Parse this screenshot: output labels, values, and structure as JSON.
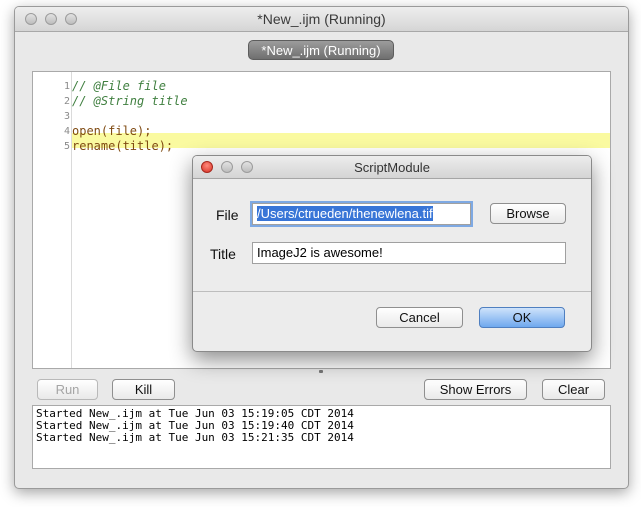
{
  "main_window": {
    "title": "*New_.ijm (Running)",
    "tab_label": "*New_.ijm (Running)"
  },
  "editor": {
    "lines": [
      {
        "num": "1",
        "text": "// @File file"
      },
      {
        "num": "2",
        "text": "// @String title"
      },
      {
        "num": "3",
        "text": ""
      },
      {
        "num": "4",
        "text": "open(file);"
      },
      {
        "num": "5",
        "text": "rename(title);"
      }
    ]
  },
  "toolbar": {
    "run_label": "Run",
    "kill_label": "Kill",
    "show_errors_label": "Show Errors",
    "clear_label": "Clear"
  },
  "console": {
    "lines": [
      "Started New_.ijm at Tue Jun 03 15:19:05 CDT 2014",
      "Started New_.ijm at Tue Jun 03 15:19:40 CDT 2014",
      "Started New_.ijm at Tue Jun 03 15:21:35 CDT 2014"
    ]
  },
  "dialog": {
    "title": "ScriptModule",
    "file_label": "File",
    "file_value": "/Users/ctrueden/thenewlena.tif",
    "browse_label": "Browse",
    "title_label": "Title",
    "title_value": "ImageJ2 is awesome!",
    "cancel_label": "Cancel",
    "ok_label": "OK"
  },
  "colors": {
    "highlight_line": "#fafaa0",
    "comment": "#3f7f3f",
    "function": "#7f4a12",
    "primary_button": "#6fa8ee"
  }
}
